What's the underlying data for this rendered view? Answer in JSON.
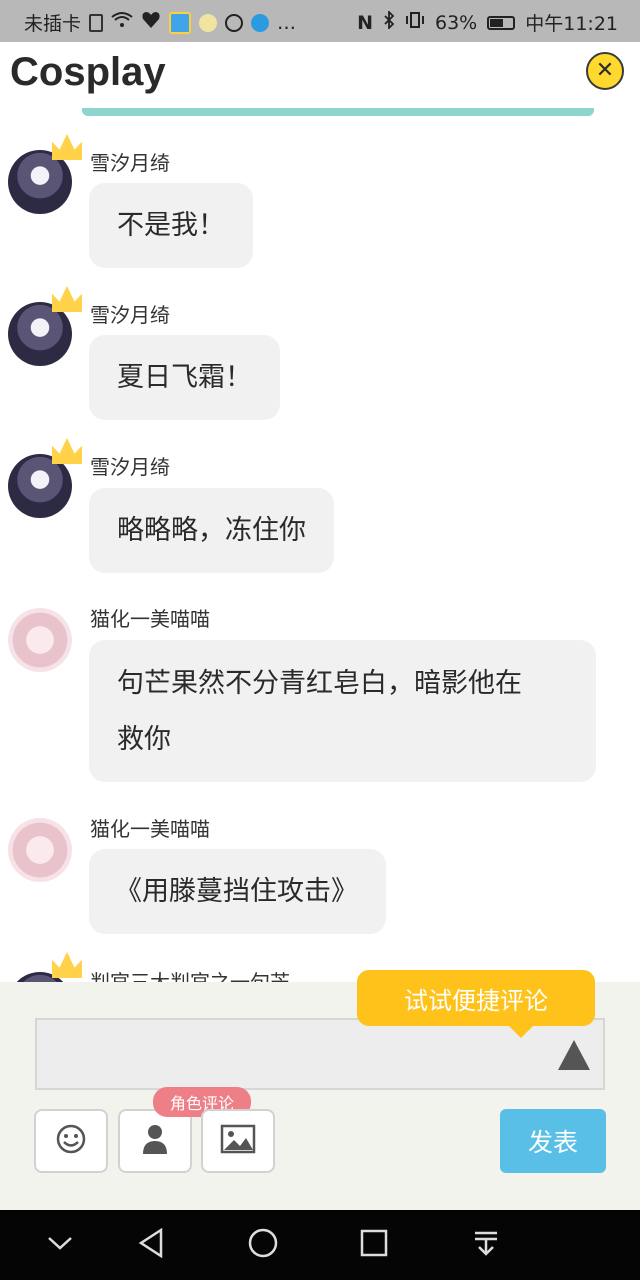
{
  "status_bar": {
    "carrier": "未插卡",
    "battery": "63%",
    "battery_level": 0.63,
    "time": "中午11:21",
    "dots": "…"
  },
  "header": {
    "title": "Cosplay",
    "close_icon": "close-icon"
  },
  "messages": [
    {
      "user": "雪汐月绮",
      "text": "不是我！"
    },
    {
      "user": "雪汐月绮",
      "text": "夏日飞霜！"
    },
    {
      "user": "雪汐月绮",
      "text": "略略略，冻住你"
    },
    {
      "user": "猫化一美喵喵",
      "text_line1": "句芒果然不分青红皂白，暗影他在",
      "text_line2": "救你"
    },
    {
      "user": "猫化一美喵喵",
      "text": "《用滕蔓挡住攻击》"
    },
    {
      "user": "判官三大判官之一句芒"
    }
  ],
  "composer": {
    "tooltip": "试试便捷评论",
    "role_tag": "角色评论",
    "send_label": "发表",
    "input_value": ""
  },
  "colors": {
    "accent_yellow": "#ffc21a",
    "send_blue": "#59bfe6",
    "role_pink": "#ef7f86",
    "bubble_gray": "#f1f1f1"
  }
}
